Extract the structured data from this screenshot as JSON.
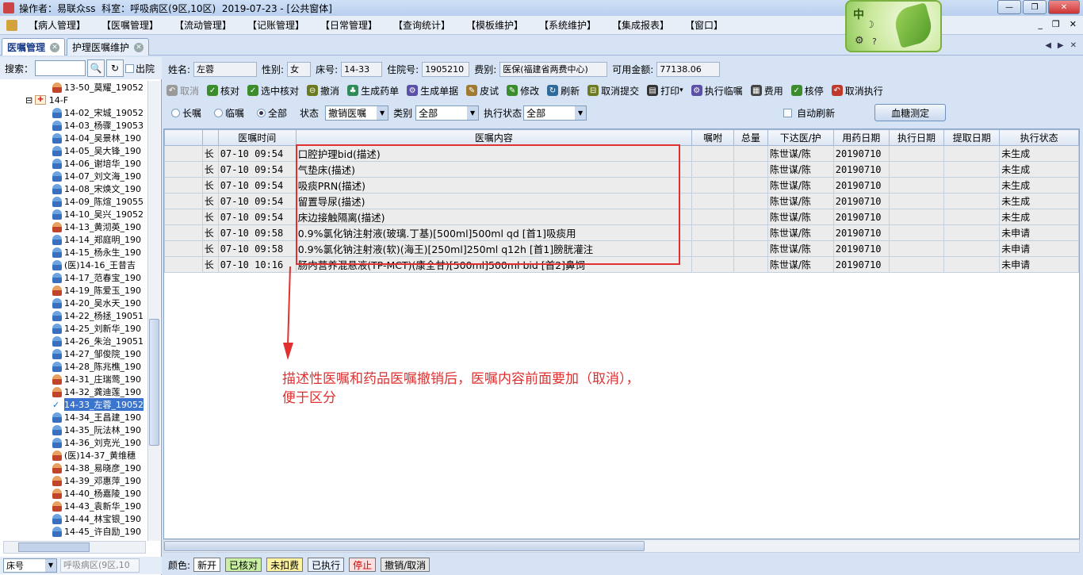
{
  "window": {
    "title": "操作者：易联众ss  科室：呼吸病区(9区,10区)  2019-07-23 - [公共窗体]"
  },
  "menu": {
    "items": [
      "【病人管理】",
      "【医嘱管理】",
      "【流动管理】",
      "【记账管理】",
      "【日常管理】",
      "【查询统计】",
      "【模板维护】",
      "【系统维护】",
      "【集成报表】",
      "【窗口】"
    ]
  },
  "widget": {
    "zh": "中"
  },
  "tabs": [
    {
      "label": "医嘱管理"
    },
    {
      "label": "护理医嘱维护"
    }
  ],
  "left": {
    "search_label": "搜索：",
    "discharged_label": "出院",
    "bed_select": "床号",
    "ward_select": "呼吸病区(9区,10",
    "tree": [
      {
        "label": "13-50_莫耀_19052",
        "gender": "f"
      },
      {
        "label": "14-F",
        "group": true
      },
      {
        "label": "14-02_宋城_19052",
        "gender": "m"
      },
      {
        "label": "14-03_杨骤_19053",
        "gender": "m"
      },
      {
        "label": "14-04_吴景林_190",
        "gender": "m"
      },
      {
        "label": "14-05_吴大锋_190",
        "gender": "m"
      },
      {
        "label": "14-06_谢培华_190",
        "gender": "m"
      },
      {
        "label": "14-07_刘文海_190",
        "gender": "m"
      },
      {
        "label": "14-08_宋焕文_190",
        "gender": "m"
      },
      {
        "label": "14-09_陈煊_19055",
        "gender": "m"
      },
      {
        "label": "14-10_吴兴_19052",
        "gender": "m"
      },
      {
        "label": "14-13_黄沏英_190",
        "gender": "f"
      },
      {
        "label": "14-14_郑庭明_190",
        "gender": "m"
      },
      {
        "label": "14-15_杨永生_190",
        "gender": "m"
      },
      {
        "label": "(医)14-16_王昔吉",
        "gender": "m"
      },
      {
        "label": "14-17_范春宝_190",
        "gender": "m"
      },
      {
        "label": "14-19_陈爱玉_190",
        "gender": "f"
      },
      {
        "label": "14-20_吴水天_190",
        "gender": "m"
      },
      {
        "label": "14-22_杨拯_19051",
        "gender": "m"
      },
      {
        "label": "14-25_刘新华_190",
        "gender": "m"
      },
      {
        "label": "14-26_朱治_19051",
        "gender": "m"
      },
      {
        "label": "14-27_邹俊院_190",
        "gender": "m"
      },
      {
        "label": "14-28_陈兆樵_190",
        "gender": "m"
      },
      {
        "label": "14-31_庄瑞莺_190",
        "gender": "f"
      },
      {
        "label": "14-32_龚迪莲_190",
        "gender": "f"
      },
      {
        "label": "14-33_左蓉_19052",
        "gender": "sel"
      },
      {
        "label": "14-34_王昌建_190",
        "gender": "m"
      },
      {
        "label": "14-35_阮法林_190",
        "gender": "m"
      },
      {
        "label": "14-36_刘克光_190",
        "gender": "m"
      },
      {
        "label": "(医)14-37_黄维穗",
        "gender": "f"
      },
      {
        "label": "14-38_易晓彦_190",
        "gender": "f"
      },
      {
        "label": "14-39_邓惠萍_190",
        "gender": "f"
      },
      {
        "label": "14-40_杨嘉陵_190",
        "gender": "f"
      },
      {
        "label": "14-43_袁新华_190",
        "gender": "f"
      },
      {
        "label": "14-44_林宝银_190",
        "gender": "m"
      },
      {
        "label": "14-45_许自励_190",
        "gender": "m"
      }
    ]
  },
  "patient": {
    "name_label": "姓名:",
    "name": "左蓉",
    "sex_label": "性别:",
    "sex": "女",
    "bed_label": "床号:",
    "bed": "14-33",
    "inpatient_label": "住院号:",
    "inpatient": "1905210",
    "fee_label": "费别:",
    "fee": "医保(福建省两费中心)",
    "balance_label": "可用金额:",
    "balance": "77138.06"
  },
  "toolbar": [
    {
      "label": "取消",
      "icon": "undo-icon",
      "color": "#9a9a9a",
      "disabled": true
    },
    {
      "label": "核对",
      "icon": "check-icon",
      "color": "#3a8d2a"
    },
    {
      "label": "选中核对",
      "icon": "check-icon",
      "color": "#3a8d2a"
    },
    {
      "label": "撤消",
      "icon": "revoke-icon",
      "color": "#6b7a20"
    },
    {
      "label": "生成药单",
      "icon": "drug-icon",
      "color": "#2e8b57"
    },
    {
      "label": "生成单据",
      "icon": "gear-icon",
      "color": "#5b4fa8"
    },
    {
      "label": "皮试",
      "icon": "syringe-icon",
      "color": "#a07a30"
    },
    {
      "label": "修改",
      "icon": "edit-icon",
      "color": "#3a8d2a"
    },
    {
      "label": "刷新",
      "icon": "refresh-icon",
      "color": "#2e6b9a"
    },
    {
      "label": "取消提交",
      "icon": "cancel-submit-icon",
      "color": "#6b7a20"
    },
    {
      "label": "打印",
      "icon": "print-icon",
      "color": "#333333"
    },
    {
      "label": "执行临嘱",
      "icon": "gear-icon",
      "color": "#5b4fa8"
    },
    {
      "label": "费用",
      "icon": "calculator-icon",
      "color": "#444444"
    },
    {
      "label": "核停",
      "icon": "check-icon",
      "color": "#3a8d2a"
    },
    {
      "label": "取消执行",
      "icon": "undo-icon",
      "color": "#c0392b"
    }
  ],
  "filters": {
    "long_label": "长嘱",
    "temp_label": "临嘱",
    "all_label": "全部",
    "status_label": "状态",
    "status_value": "撤销医嘱",
    "type_label": "类别",
    "type_value": "全部",
    "exec_label": "执行状态",
    "exec_value": "全部",
    "auto_refresh_label": "自动刷新",
    "blood_button": "血糖测定"
  },
  "grid": {
    "columns": [
      "",
      "",
      "医嘱时间",
      "医嘱内容",
      "嘱咐",
      "总量",
      "下达医/护",
      "用药日期",
      "执行日期",
      "提取日期",
      "执行状态"
    ],
    "rows": [
      {
        "type": "长",
        "time": "07-10 09:54",
        "content": "口腔护理bid(描述)",
        "note": "",
        "total": "",
        "doctor": "陈世谋/陈",
        "date": "20190710",
        "exec_date": "",
        "fetch_date": "",
        "status": "未生成"
      },
      {
        "type": "长",
        "time": "07-10 09:54",
        "content": "气垫床(描述)",
        "note": "",
        "total": "",
        "doctor": "陈世谋/陈",
        "date": "20190710",
        "exec_date": "",
        "fetch_date": "",
        "status": "未生成"
      },
      {
        "type": "长",
        "time": "07-10 09:54",
        "content": "吸痰PRN(描述)",
        "note": "",
        "total": "",
        "doctor": "陈世谋/陈",
        "date": "20190710",
        "exec_date": "",
        "fetch_date": "",
        "status": "未生成"
      },
      {
        "type": "长",
        "time": "07-10 09:54",
        "content": "留置导尿(描述)",
        "note": "",
        "total": "",
        "doctor": "陈世谋/陈",
        "date": "20190710",
        "exec_date": "",
        "fetch_date": "",
        "status": "未生成"
      },
      {
        "type": "长",
        "time": "07-10 09:54",
        "content": "床边接触隔离(描述)",
        "note": "",
        "total": "",
        "doctor": "陈世谋/陈",
        "date": "20190710",
        "exec_date": "",
        "fetch_date": "",
        "status": "未生成"
      },
      {
        "type": "长",
        "time": "07-10 09:58",
        "content": "0.9%氯化钠注射液(玻璃.丁基)[500ml]500ml qd [首1]吸痰用",
        "note": "",
        "total": "",
        "doctor": "陈世谋/陈",
        "date": "20190710",
        "exec_date": "",
        "fetch_date": "",
        "status": "未申请"
      },
      {
        "type": "长",
        "time": "07-10 09:58",
        "content": "0.9%氯化钠注射液(软)(海王)[250ml]250ml q12h [首1]膀胱灌注",
        "note": "",
        "total": "",
        "doctor": "陈世谋/陈",
        "date": "20190710",
        "exec_date": "",
        "fetch_date": "",
        "status": "未申请"
      },
      {
        "type": "长",
        "time": "07-10 10:16",
        "content": "肠内营养混悬液(TP-MCT)(康全甘)[500ml]500ml bid [首2]鼻饲",
        "note": "",
        "total": "",
        "doctor": "陈世谋/陈",
        "date": "20190710",
        "exec_date": "",
        "fetch_date": "",
        "status": "未申请"
      }
    ]
  },
  "annotation": {
    "line1": "描述性医嘱和药品医嘱撤销后，医嘱内容前面要加（取消），",
    "line2": "便于区分",
    "color": "#e03030"
  },
  "legend": {
    "label": "颜色:",
    "items": [
      {
        "label": "新开",
        "color": "#ffffff"
      },
      {
        "label": "已核对",
        "color": "#c8f0a0"
      },
      {
        "label": "未扣费",
        "color": "#fff3a0"
      },
      {
        "label": "已执行",
        "color": "#e6f0ff"
      },
      {
        "label": "停止",
        "color": "#ffe0e0"
      },
      {
        "label": "撤销/取消",
        "color": "#e6e6e6"
      }
    ]
  }
}
